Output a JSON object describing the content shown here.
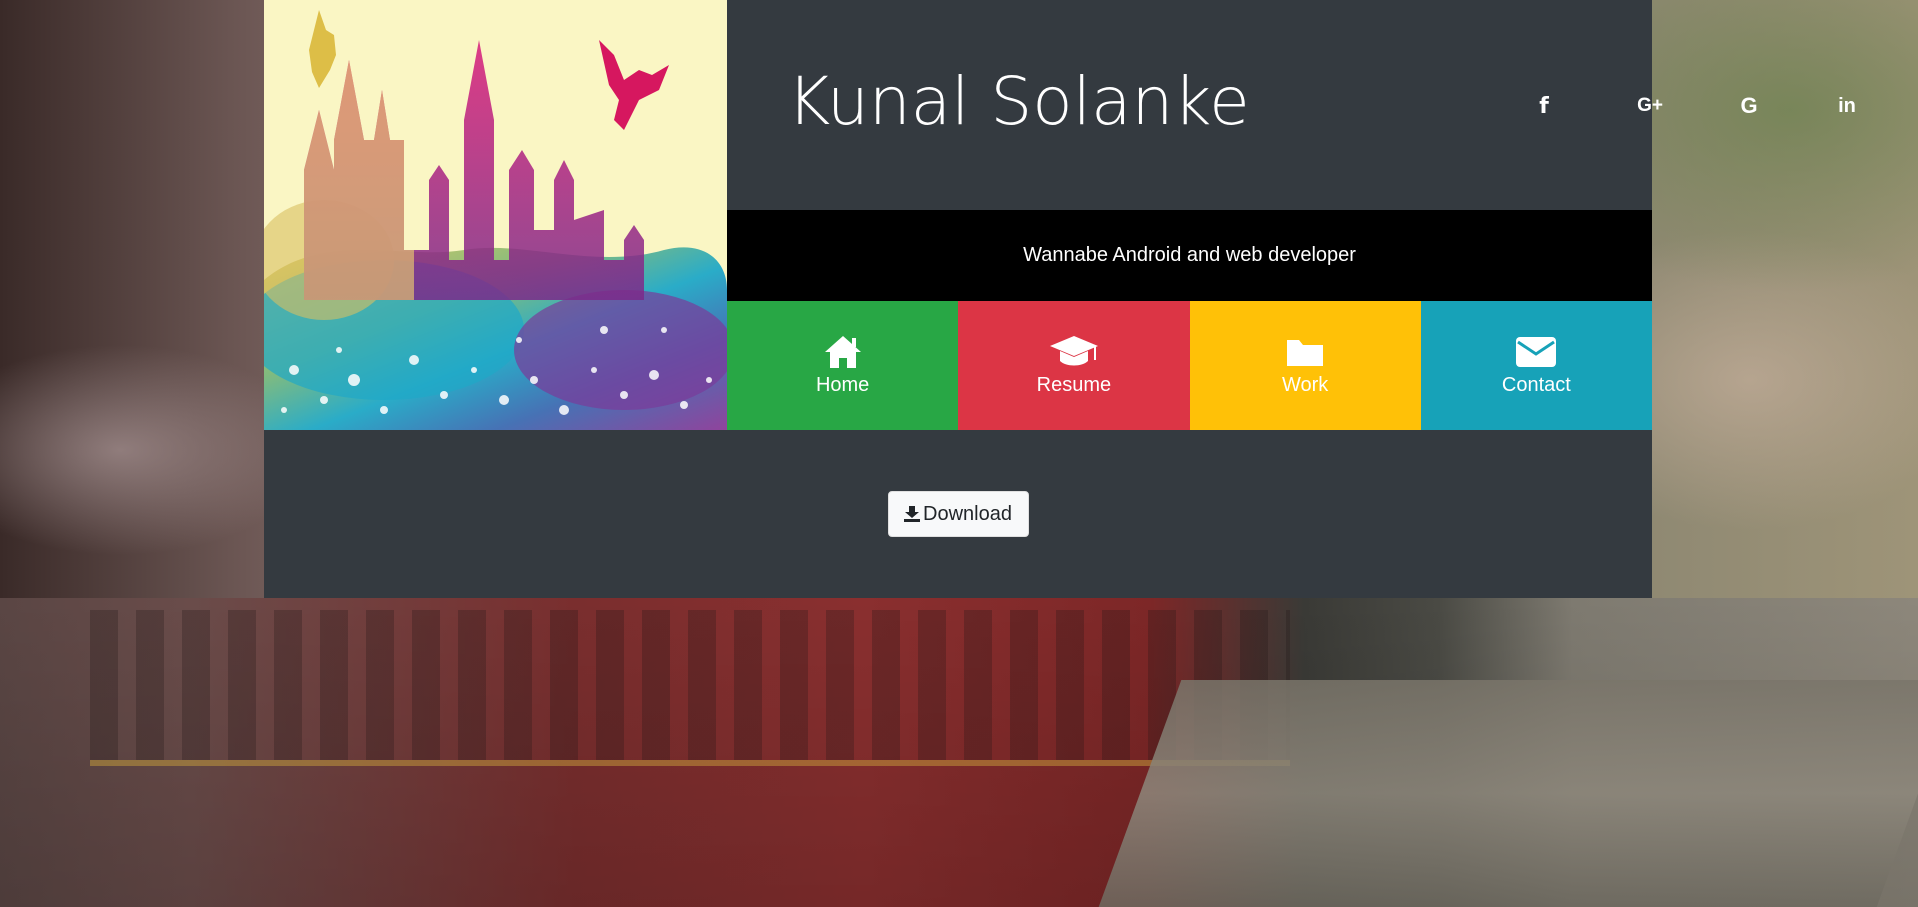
{
  "header": {
    "title": "Kunal Solanke",
    "tagline": "Wannabe Android and web developer"
  },
  "social": [
    {
      "name": "facebook",
      "icon": "facebook-icon",
      "glyph": "f"
    },
    {
      "name": "google-plus",
      "icon": "google-plus-icon",
      "glyph": "G+"
    },
    {
      "name": "google",
      "icon": "google-icon",
      "glyph": "G"
    },
    {
      "name": "linkedin",
      "icon": "linkedin-icon",
      "glyph": "in"
    }
  ],
  "nav": {
    "items": [
      {
        "label": "Home",
        "icon": "home-icon",
        "color": "#28a745"
      },
      {
        "label": "Resume",
        "icon": "graduation-cap-icon",
        "color": "#dc3545"
      },
      {
        "label": "Work",
        "icon": "folder-icon",
        "color": "#ffc107"
      },
      {
        "label": "Contact",
        "icon": "envelope-icon",
        "color": "#17a2b8"
      }
    ]
  },
  "download": {
    "label": "Download",
    "icon": "download-icon"
  },
  "colors": {
    "card_bg": "#343a40",
    "tagline_bg": "#000000",
    "art_bg": "#faf6c4"
  }
}
